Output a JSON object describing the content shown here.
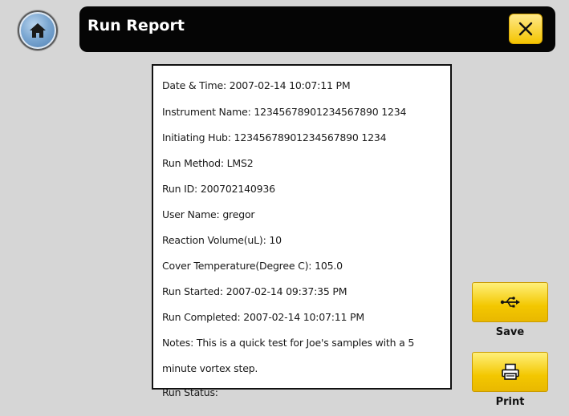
{
  "header": {
    "title": "Run Report"
  },
  "report": {
    "lines": [
      "Date & Time: 2007-02-14 10:07:11 PM",
      "Instrument Name: 12345678901234567890 1234",
      "Initiating Hub: 12345678901234567890 1234",
      "Run Method: LMS2",
      "Run ID: 200702140936",
      "User Name: gregor",
      "Reaction Volume(uL): 10",
      "Cover Temperature(Degree C): 105.0",
      "Run Started: 2007-02-14 09:37:35 PM",
      "Run Completed: 2007-02-14 10:07:11 PM",
      "Notes: This is a quick test for Joe's samples with a 5",
      "minute vortex step.",
      "Run Status:"
    ]
  },
  "actions": {
    "save_label": "Save",
    "print_label": "Print"
  },
  "icons": {
    "home": "home-icon",
    "close": "close-icon",
    "save": "usb-icon",
    "print": "printer-icon"
  },
  "colors": {
    "accent_yellow": "#f3c700",
    "titlebar": "#050505",
    "home_blue": "#4b7cb0"
  }
}
